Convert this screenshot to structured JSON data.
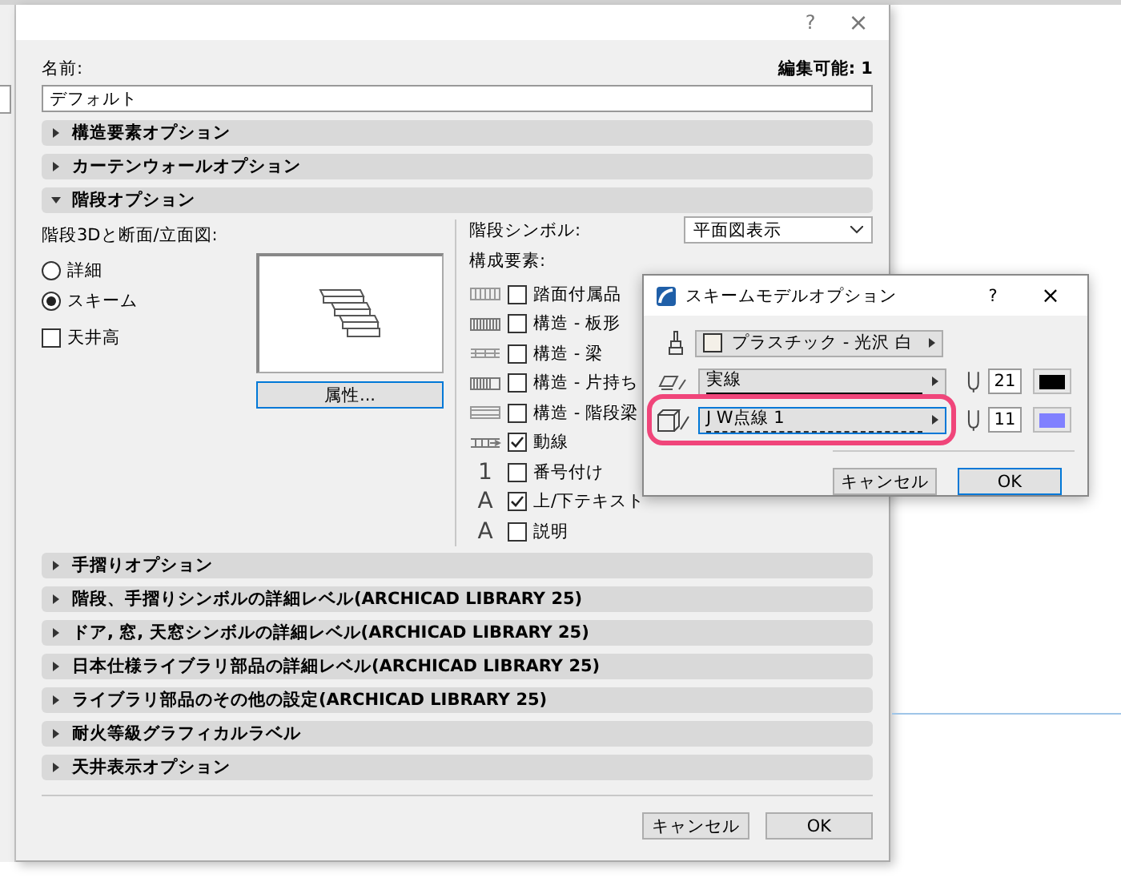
{
  "window": {
    "help": "?",
    "close": "×"
  },
  "name_label": "名前:",
  "editable": "編集可能: 1",
  "name_value": "デフォルト",
  "sections_top": [
    {
      "label": "構造要素オプション",
      "expanded": false
    },
    {
      "label": "カーテンウォールオプション",
      "expanded": false
    },
    {
      "label": "階段オプション",
      "expanded": true
    }
  ],
  "stair": {
    "view_label": "階段3Dと断面/立面図:",
    "radios": [
      {
        "label": "詳細",
        "selected": false
      },
      {
        "label": "スキーム",
        "selected": true
      }
    ],
    "ceiling": {
      "label": "天井高",
      "checked": false
    },
    "attributes_button": "属性...",
    "symbol_label": "階段シンボル:",
    "symbol_value": "平面図表示",
    "components_label": "構成要素:",
    "components": [
      {
        "kind": "hatch",
        "label": "踏面付属品",
        "checked": false
      },
      {
        "kind": "hatch",
        "label": "構造 - 板形",
        "checked": false
      },
      {
        "kind": "hatch",
        "label": "構造 - 梁",
        "checked": false
      },
      {
        "kind": "hatch",
        "label": "構造 - 片持ち",
        "checked": false
      },
      {
        "kind": "hatch",
        "label": "構造 - 階段梁",
        "checked": false
      },
      {
        "kind": "hatch",
        "label": "動線",
        "checked": true
      },
      {
        "kind": "glyph",
        "glyph": "1",
        "label": "番号付け",
        "checked": false
      },
      {
        "kind": "glyph",
        "glyph": "A",
        "label": "上/下テキスト",
        "checked": true
      },
      {
        "kind": "glyph",
        "glyph": "A",
        "label": "説明",
        "checked": false
      }
    ]
  },
  "sections_bottom": [
    {
      "label": "手摺りオプション",
      "expanded": false
    },
    {
      "label": "階段、手摺りシンボルの詳細レベル(ARCHICAD LIBRARY 25)",
      "expanded": false
    },
    {
      "label": "ドア, 窓, 天窓シンボルの詳細レベル(ARCHICAD LIBRARY 25)",
      "expanded": false
    },
    {
      "label": "日本仕様ライブラリ部品の詳細レベル(ARCHICAD LIBRARY 25)",
      "expanded": false
    },
    {
      "label": "ライブラリ部品のその他の設定(ARCHICAD LIBRARY 25)",
      "expanded": false
    },
    {
      "label": "耐火等級グラフィカルラベル",
      "expanded": false
    },
    {
      "label": "天井表示オプション",
      "expanded": false
    }
  ],
  "buttons": [
    "キャンセル",
    "OK"
  ],
  "scheme_dialog": {
    "title": "スキームモデルオプション",
    "help": "?",
    "close": "×",
    "material": "プラスチック - 光沢 白",
    "rows": [
      {
        "kind": "solid",
        "line": "実線",
        "pen": "21",
        "color": "#000000",
        "highlighted": false
      },
      {
        "kind": "dashed",
        "line": "J W点線 1",
        "pen": "11",
        "color": "#8080ff",
        "highlighted": true
      }
    ],
    "buttons": [
      {
        "label": "キャンセル",
        "default": false
      },
      {
        "label": "OK",
        "default": true
      }
    ]
  }
}
